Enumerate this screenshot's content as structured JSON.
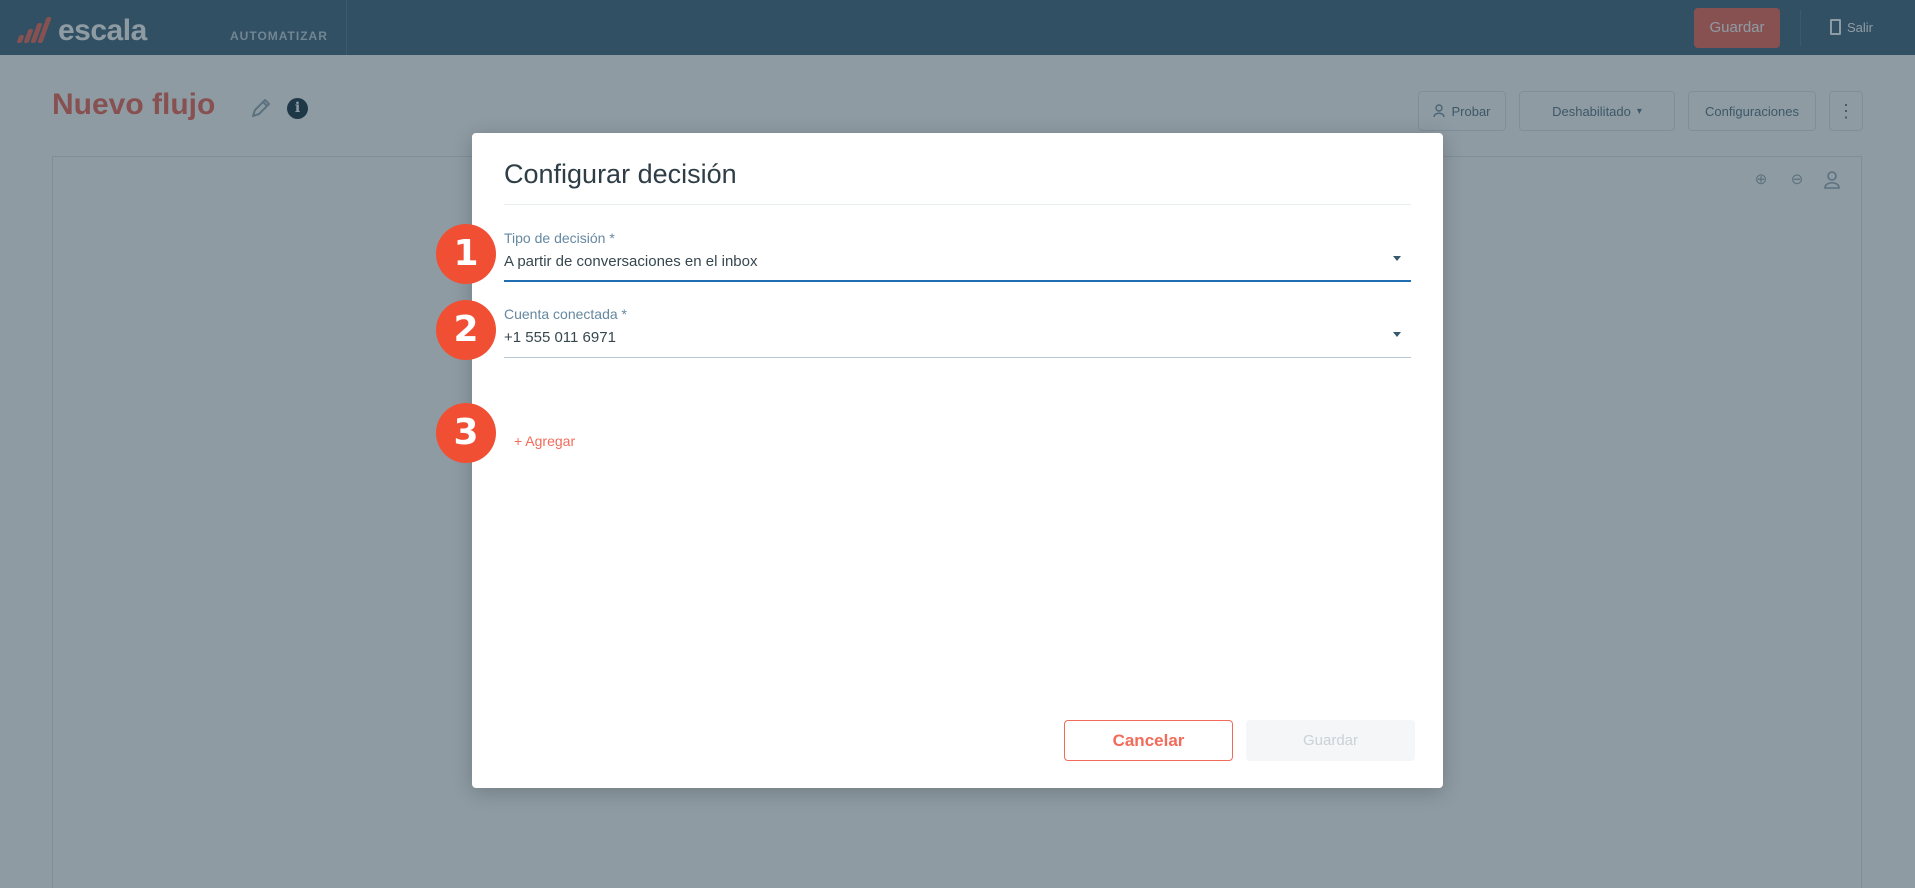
{
  "app": {
    "logo": "escala",
    "nav_section": "AUTOMATIZAR"
  },
  "topbar": {
    "save_label": "Guardar",
    "exit_label": "Salir"
  },
  "page": {
    "title": "Nuevo flujo"
  },
  "header_buttons": {
    "test": "Probar",
    "status": "Deshabilitado",
    "settings": "Configuraciones",
    "more": "⋮"
  },
  "canvas_tools": {
    "zoom_in": "⊕",
    "zoom_out": "⊖",
    "user": "👤"
  },
  "modal": {
    "title": "Configurar decisión",
    "decision_type": {
      "label": "Tipo de decisión *",
      "value": "A partir de conversaciones en el inbox"
    },
    "connected_account": {
      "label": "Cuenta conectada *",
      "value": "+1 555 011 6971"
    },
    "add_label": "+ Agregar",
    "cancel_label": "Cancelar",
    "save_label": "Guardar"
  },
  "badges": [
    "1",
    "2",
    "3"
  ],
  "colors": {
    "brand": "#f26b5b",
    "nav": "#46687f",
    "badge": "#f04f34",
    "active_underline": "#1f6fb2"
  }
}
